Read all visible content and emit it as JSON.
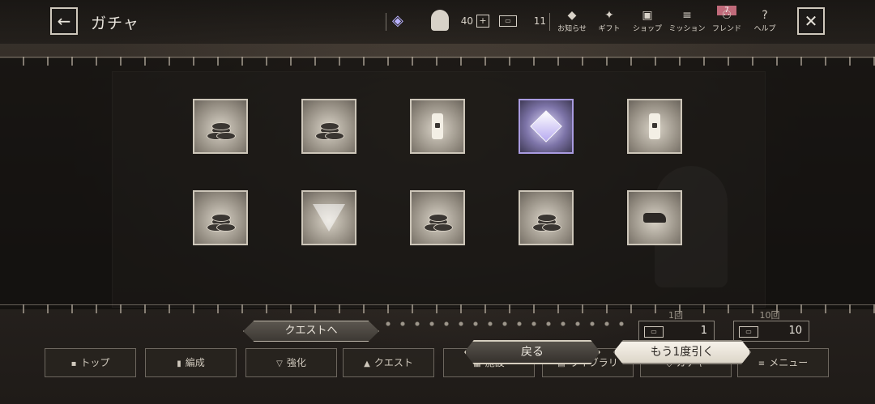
{
  "header": {
    "title": "ガチャ",
    "stamina": "40",
    "plus": "+",
    "ticket_icon": "ticket-icon",
    "tickets": "11",
    "nav": [
      {
        "label": "お知らせ",
        "icon": "◆"
      },
      {
        "label": "ギフト",
        "icon": "✦"
      },
      {
        "label": "ショップ",
        "icon": "▣"
      },
      {
        "label": "ミッション",
        "icon": "≡"
      },
      {
        "label": "フレンド",
        "icon": "⚇"
      },
      {
        "label": "ヘルプ",
        "icon": "?"
      }
    ],
    "friend_badge": "7"
  },
  "results": {
    "items": [
      {
        "type": "coins"
      },
      {
        "type": "coins"
      },
      {
        "type": "key"
      },
      {
        "type": "cube",
        "rare": true
      },
      {
        "type": "key"
      },
      {
        "type": "coins"
      },
      {
        "type": "emblem"
      },
      {
        "type": "coins"
      },
      {
        "type": "coins"
      },
      {
        "type": "rock"
      }
    ]
  },
  "actions": {
    "quest": "クエストへ",
    "return": "戻る",
    "again": "もう1度引く",
    "single_label": "1回",
    "single_cost": "1",
    "multi_label": "10回",
    "multi_cost": "10"
  },
  "bottom_nav": [
    {
      "label": "トップ",
      "icon": "▪"
    },
    {
      "label": "編成",
      "icon": "▮"
    },
    {
      "label": "強化",
      "icon": "▽"
    },
    {
      "label": "クエスト",
      "icon": "▲"
    },
    {
      "label": "施設",
      "icon": "▦"
    },
    {
      "label": "ライブラリ",
      "icon": "▤"
    },
    {
      "label": "ガチャ",
      "icon": "◇"
    },
    {
      "label": "メニュー",
      "icon": "≡"
    }
  ],
  "colors": {
    "accent": "#cdc6b9",
    "rare": "#a99be0",
    "badge": "#c06a7a"
  }
}
